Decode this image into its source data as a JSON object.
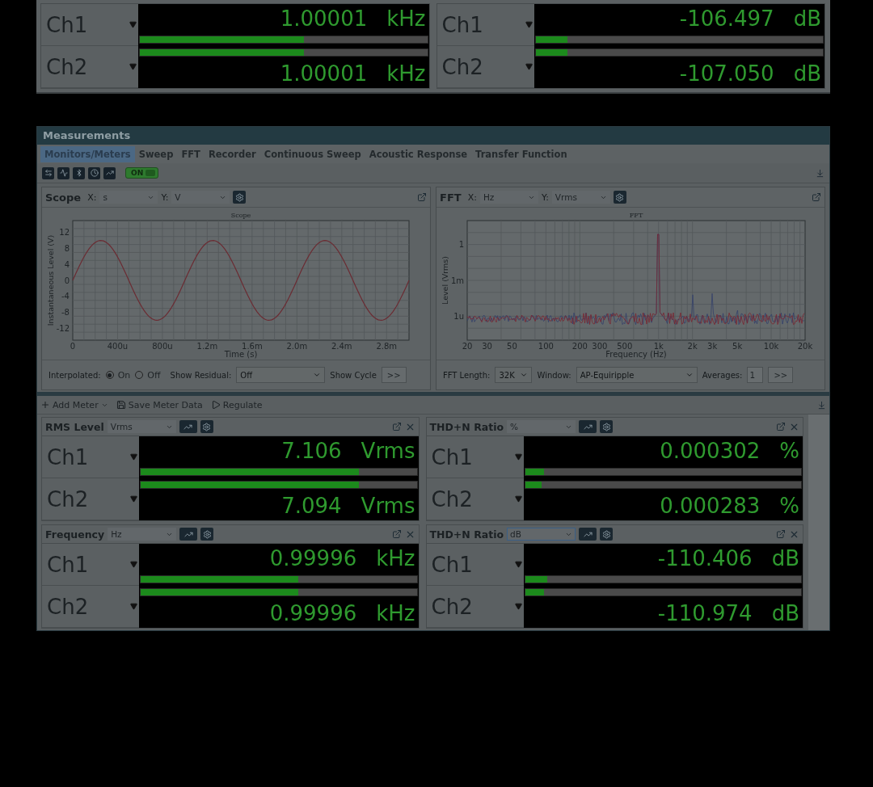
{
  "top_meters": [
    {
      "channels": [
        {
          "label": "Ch1",
          "value": "1.00001",
          "unit": "kHz",
          "level": 0.57
        },
        {
          "label": "Ch2",
          "value": "1.00001",
          "unit": "kHz",
          "level": 0.57
        }
      ]
    },
    {
      "channels": [
        {
          "label": "Ch1",
          "value": "-106.497",
          "unit": "dB",
          "level": 0.11
        },
        {
          "label": "Ch2",
          "value": "-107.050",
          "unit": "dB",
          "level": 0.11
        }
      ]
    }
  ],
  "measurements": {
    "title": "Measurements",
    "tabs": [
      {
        "label": "Monitors/Meters",
        "selected": true
      },
      {
        "label": "Sweep",
        "selected": false
      },
      {
        "label": "FFT",
        "selected": false
      },
      {
        "label": "Recorder",
        "selected": false
      },
      {
        "label": "Continuous Sweep",
        "selected": false
      },
      {
        "label": "Acoustic Response",
        "selected": false
      },
      {
        "label": "Transfer Function",
        "selected": false
      }
    ],
    "power": {
      "label": "ON",
      "on": true
    },
    "scope": {
      "title": "Scope",
      "x_label": "X:",
      "x_unit": "s",
      "y_label": "Y:",
      "y_unit": "V",
      "plot": {
        "kind": "scope",
        "title": "Scope",
        "xlabel": "Time (s)",
        "ylabel": "Instantaneous Level (V)",
        "traces": [
          {
            "color": "#6b2b32"
          }
        ],
        "xtick_labels": [
          "0",
          "400u",
          "800u",
          "1.2m",
          "1.6m",
          "2.0m",
          "2.4m",
          "2.8m"
        ],
        "ytick_labels": [
          "12",
          "8",
          "4",
          "0",
          "-4",
          "-8",
          "-12"
        ]
      },
      "interpolated": {
        "label": "Interpolated:",
        "options": [
          {
            "label": "On",
            "selected": true
          },
          {
            "label": "Off",
            "selected": false
          }
        ]
      },
      "residual": {
        "label": "Show Residual:",
        "value": "Off"
      },
      "cycle": {
        "label": "Show Cycle",
        "button": ">>"
      }
    },
    "fft": {
      "title": "FFT",
      "x_label": "X:",
      "x_unit": "Hz",
      "y_label": "Y:",
      "y_unit": "Vrms",
      "plot": {
        "kind": "spectrum",
        "title": "FFT",
        "xlabel": "Frequency (Hz)",
        "ylabel": "Level (Vrms)",
        "traces": [
          {
            "color": "#34406a"
          },
          {
            "color": "#7a2530"
          }
        ],
        "xtick_labels": [
          "20",
          "30",
          "50",
          "100",
          "200",
          "300",
          "500",
          "1k",
          "2k",
          "3k",
          "5k",
          "10k",
          "20k"
        ],
        "ytick_labels": [
          "1",
          "1m",
          "1u"
        ]
      },
      "length": {
        "label": "FFT Length:",
        "value": "32K"
      },
      "window": {
        "label": "Window:",
        "value": "AP-Equiripple"
      },
      "averages": {
        "label": "Averages:",
        "value": "1",
        "button": ">>"
      }
    },
    "meter_toolbar": [
      {
        "label": "Add Meter",
        "kind": "add"
      },
      {
        "label": "Save Meter Data",
        "kind": "save"
      },
      {
        "label": "Regulate",
        "kind": "run"
      }
    ],
    "meters": [
      {
        "title": "RMS Level",
        "unit": "Vrms",
        "focused": false,
        "channels": [
          {
            "label": "Ch1",
            "value": "7.106",
            "unit": "Vrms",
            "level": 0.79
          },
          {
            "label": "Ch2",
            "value": "7.094",
            "unit": "Vrms",
            "level": 0.79
          }
        ]
      },
      {
        "title": "THD+N Ratio",
        "unit": "%",
        "focused": false,
        "channels": [
          {
            "label": "Ch1",
            "value": "0.000302",
            "unit": "%",
            "level": 0.07
          },
          {
            "label": "Ch2",
            "value": "0.000283",
            "unit": "%",
            "level": 0.06
          }
        ]
      },
      {
        "title": "Frequency",
        "unit": "Hz",
        "focused": false,
        "channels": [
          {
            "label": "Ch1",
            "value": "0.99996",
            "unit": "kHz",
            "level": 0.57
          },
          {
            "label": "Ch2",
            "value": "0.99996",
            "unit": "kHz",
            "level": 0.57
          }
        ]
      },
      {
        "title": "THD+N Ratio",
        "unit": "dB",
        "focused": true,
        "channels": [
          {
            "label": "Ch1",
            "value": "-110.406",
            "unit": "dB",
            "level": 0.08
          },
          {
            "label": "Ch2",
            "value": "-110.974",
            "unit": "dB",
            "level": 0.07
          }
        ]
      }
    ]
  }
}
